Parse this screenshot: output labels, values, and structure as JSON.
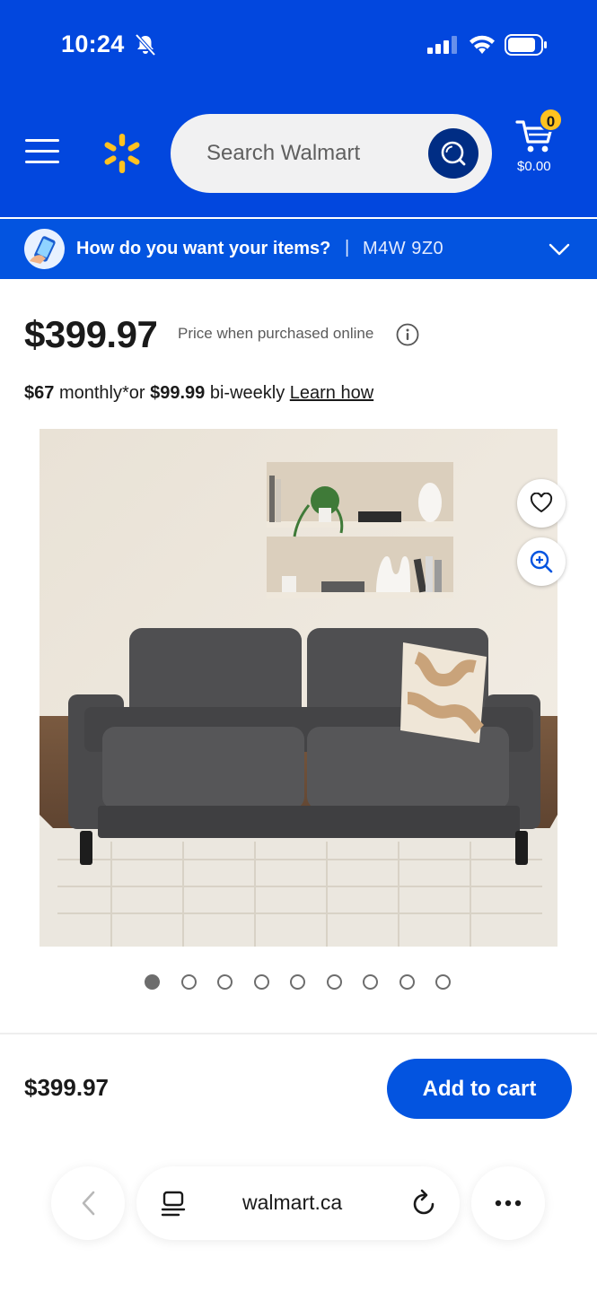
{
  "status_bar": {
    "time": "10:24"
  },
  "header": {
    "search": {
      "placeholder": "Search Walmart"
    },
    "cart": {
      "count": "0",
      "total": "$0.00"
    }
  },
  "delivery": {
    "question": "How do you want your items?",
    "separator": "|",
    "postal_code": "M4W 9Z0"
  },
  "product": {
    "price": "$399.97",
    "price_note": "Price when purchased online",
    "financing": {
      "monthly_amount": "$67",
      "monthly_text": "monthly*or",
      "biweekly_amount": "$99.99",
      "biweekly_text": "bi-weekly",
      "learn_label": "Learn how"
    },
    "image_count": 9,
    "active_image": 1
  },
  "buy_bar": {
    "price": "$399.97",
    "add_to_cart_label": "Add to cart"
  },
  "browser": {
    "url": "walmart.ca"
  },
  "colors": {
    "brand_blue": "#0247de",
    "delivery_blue": "#0354e0",
    "spark_yellow": "#ffc220",
    "search_btn": "#002d84"
  }
}
